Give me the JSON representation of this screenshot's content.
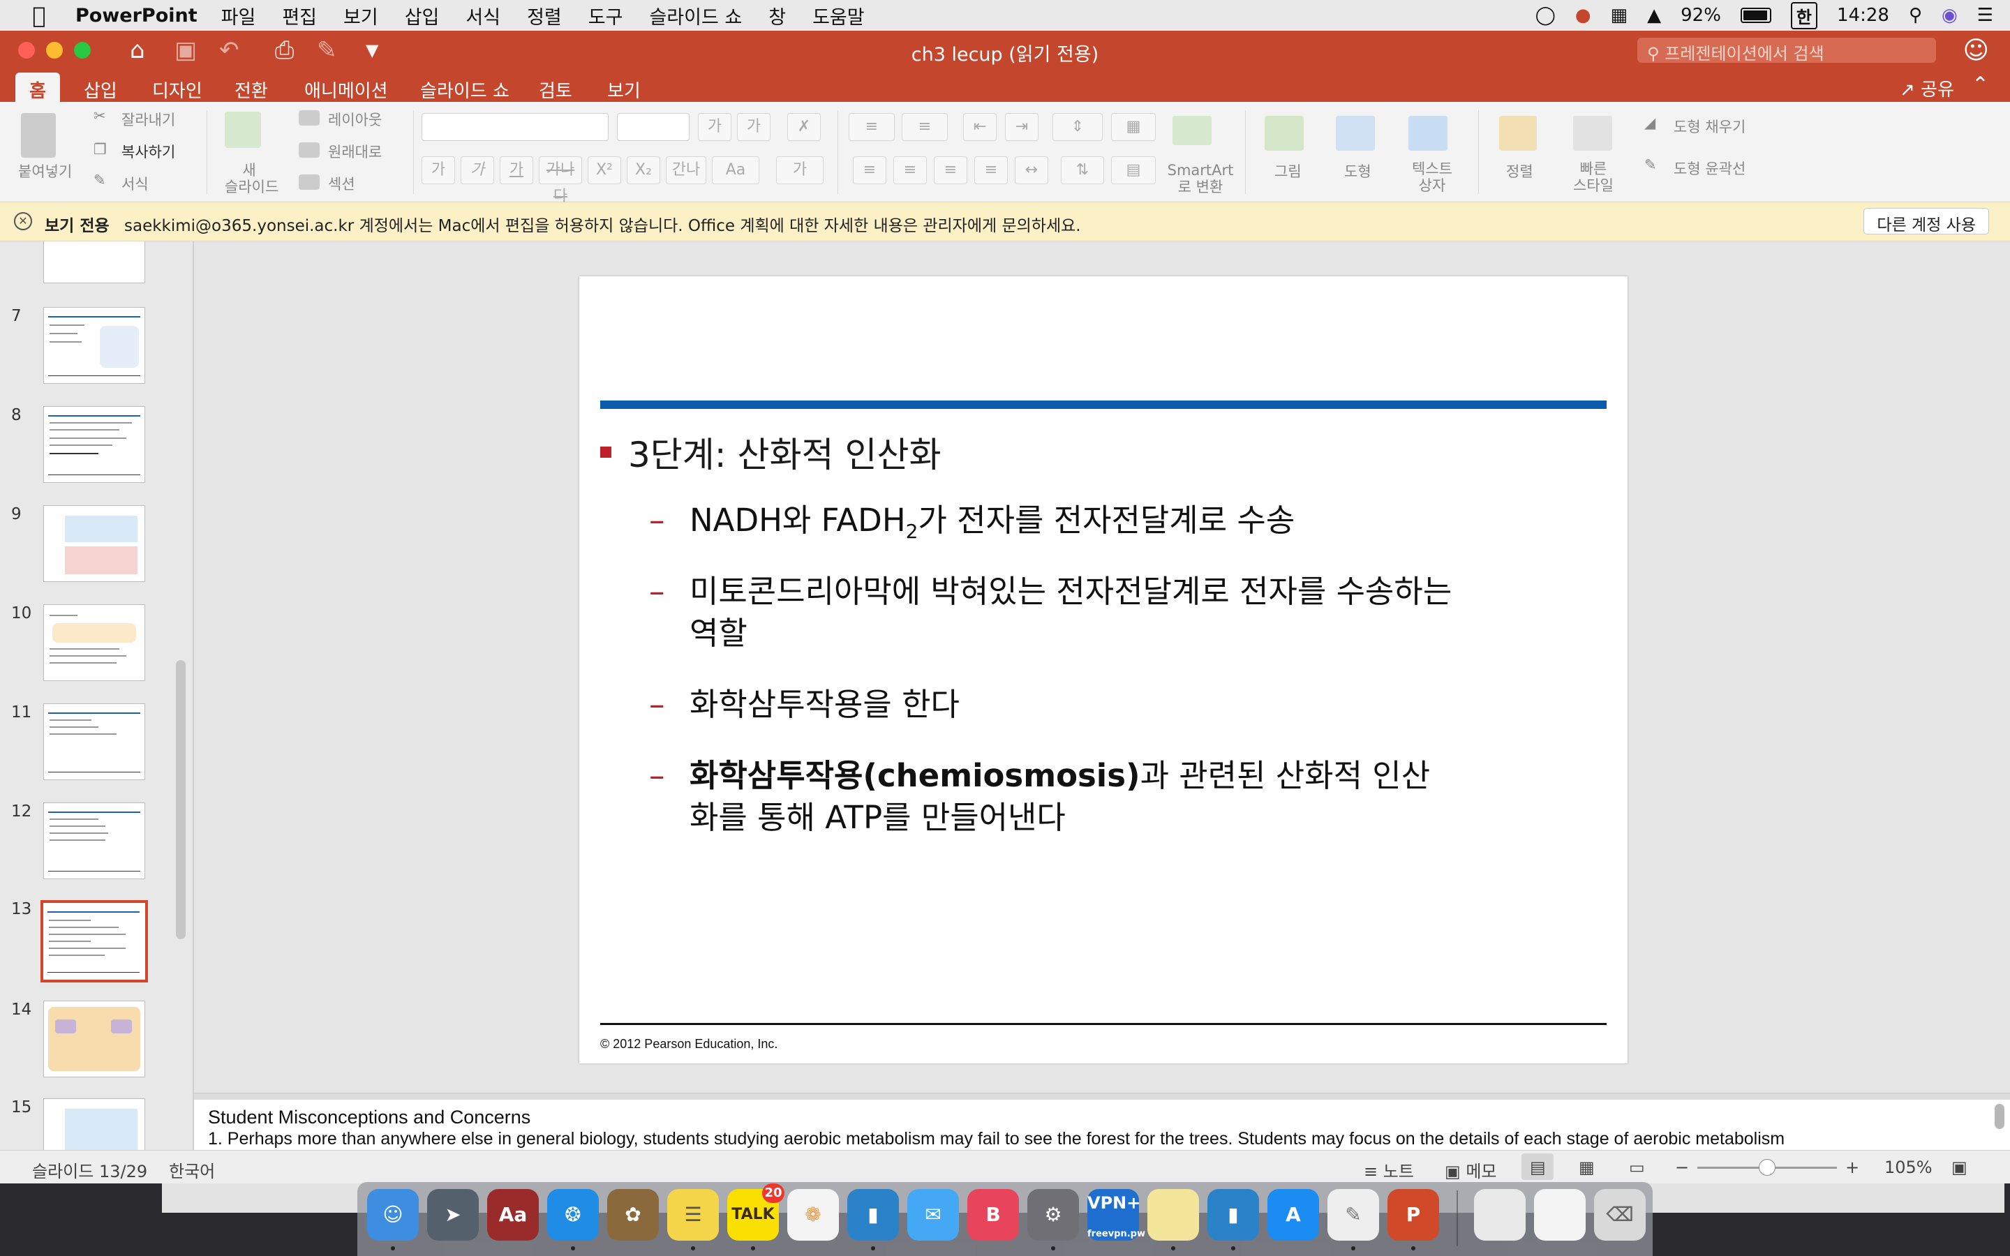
{
  "menubar": {
    "app_name": "PowerPoint",
    "items": [
      "파일",
      "편집",
      "보기",
      "삽입",
      "서식",
      "정렬",
      "도구",
      "슬라이드 쇼",
      "창",
      "도움말"
    ],
    "battery": "92%",
    "input_lang": "한",
    "time": "14:28"
  },
  "window": {
    "title": "ch3 lecup (읽기 전용)",
    "search_placeholder": "프레젠테이션에서 검색"
  },
  "ribbon_tabs": {
    "items": [
      "홈",
      "삽입",
      "디자인",
      "전환",
      "애니메이션",
      "슬라이드 쇼",
      "검토",
      "보기"
    ],
    "active": "홈",
    "share_label": "공유"
  },
  "ribbon": {
    "paste": "붙여넣기",
    "cut": "잘라내기",
    "copy": "복사하기",
    "format": "서식",
    "new_slide_1": "새",
    "new_slide_2": "슬라이드",
    "layout": "레이아웃",
    "reset": "원래대로",
    "section": "섹션",
    "smartart_1": "SmartArt",
    "smartart_2": "로 변환",
    "picture": "그림",
    "shape": "도형",
    "textbox_1": "텍스트",
    "textbox_2": "상자",
    "arrange": "정렬",
    "quick_styles_1": "빠른",
    "quick_styles_2": "스타일",
    "shape_fill": "도형 채우기",
    "shape_outline": "도형 윤곽선",
    "font_buttons": [
      "가",
      "가",
      "가",
      "가나다",
      "X²",
      "X₂",
      "간나",
      "Aa",
      "가"
    ]
  },
  "message_bar": {
    "label": "보기 전용",
    "text": "saekkimi@o365.yonsei.ac.kr 계정에서는 Mac에서 편집을 허용하지 않습니다. Office 계획에 대한 자세한 내용은 관리자에게 문의하세요.",
    "button": "다른 계정 사용"
  },
  "thumbnails": {
    "numbers": [
      "7",
      "8",
      "9",
      "10",
      "11",
      "12",
      "13",
      "14",
      "15"
    ],
    "selected": "13"
  },
  "slide": {
    "title": "3단계: 산화적 인산화",
    "bullet1_a": "NADH와 FADH",
    "bullet1_sub": "2",
    "bullet1_b": "가 전자를 전자전달계로 수송",
    "bullet2": "미토콘드리아막에 박혀있는 전자전달계로 전자를 수송하는 역할",
    "bullet3": "화학삼투작용을 한다",
    "bullet4_bold": "화학삼투작용(chemiosmosis)",
    "bullet4_rest": "과 관련된 산화적 인산화를 통해 ATP를 만들어낸다",
    "dash": "–",
    "footer": "© 2012 Pearson Education, Inc."
  },
  "notes": {
    "title": "Student Misconceptions and Concerns",
    "text": "1. Perhaps more than anywhere else in general biology, students studying aerobic metabolism may fail to see the forest for the trees. Students may focus on the details of each stage of aerobic metabolism"
  },
  "status": {
    "slide_pos": "슬라이드 13/29",
    "language": "한국어",
    "notes": "노트",
    "comments": "메모",
    "zoom": "105%"
  },
  "dock": {
    "talk_badge": "20",
    "vpn_label": "VPN+",
    "vpn_sub": "freevpn.pw"
  },
  "colors": {
    "accent": "#c4472d",
    "slide_rule": "#0b5cad",
    "bullet": "#c0202a"
  }
}
